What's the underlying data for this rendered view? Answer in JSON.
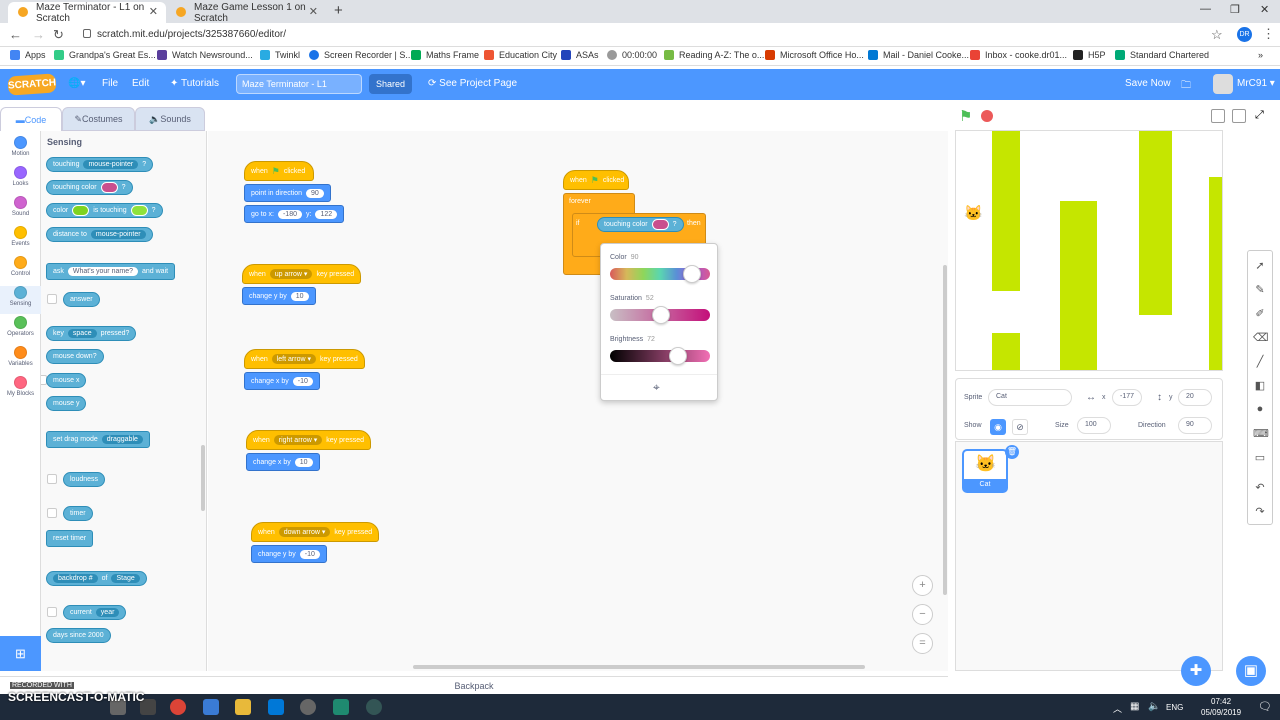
{
  "browser": {
    "tabs": [
      {
        "label": "Maze Terminator - L1 on Scratch"
      },
      {
        "label": "Maze Game Lesson 1 on Scratch"
      }
    ],
    "url": "scratch.mit.edu/projects/325387660/editor/",
    "profile": "DR",
    "bookmarks": [
      "Apps",
      "Grandpa's Great Es...",
      "Watch Newsround...",
      "Twinkl",
      "Screen Recorder | S...",
      "Maths Frame",
      "Education City",
      "ASAs",
      "00:00:00",
      "Reading A-Z: The o...",
      "Microsoft Office Ho...",
      "Mail - Daniel Cooke...",
      "Inbox - cooke.dr01...",
      "H5P",
      "Standard Chartered"
    ]
  },
  "menubar": {
    "logo": "SCRATCH",
    "file": "File",
    "edit": "Edit",
    "tutorials": "Tutorials",
    "project_title": "Maze Terminator - L1",
    "shared": "Shared",
    "see_project": "See Project Page",
    "save_now": "Save Now",
    "username": "MrC91"
  },
  "editor_tabs": {
    "code": "Code",
    "costumes": "Costumes",
    "sounds": "Sounds"
  },
  "categories": [
    {
      "label": "Motion",
      "color": "#4c97ff"
    },
    {
      "label": "Looks",
      "color": "#9966ff"
    },
    {
      "label": "Sound",
      "color": "#cf63cf"
    },
    {
      "label": "Events",
      "color": "#ffbf00"
    },
    {
      "label": "Control",
      "color": "#ffab19"
    },
    {
      "label": "Sensing",
      "color": "#5cb1d6"
    },
    {
      "label": "Operators",
      "color": "#59c059"
    },
    {
      "label": "Variables",
      "color": "#ff8c1a"
    },
    {
      "label": "My Blocks",
      "color": "#ff6680"
    }
  ],
  "palette": {
    "section": "Sensing",
    "touching": "touching",
    "mouse_pointer": "mouse-pointer",
    "q": "?",
    "touching_color": "touching color",
    "color": "color",
    "is_touching": "is touching",
    "distance_to": "distance to",
    "ask": "ask",
    "ask_default": "What's your name?",
    "and_wait": "and wait",
    "answer": "answer",
    "key": "key",
    "space": "space",
    "pressed": "pressed?",
    "mouse_down": "mouse down?",
    "mouse_x": "mouse x",
    "mouse_y": "mouse y",
    "set_drag": "set drag mode",
    "draggable": "draggable",
    "loudness": "loudness",
    "timer": "timer",
    "reset_timer": "reset timer",
    "backdrop": "backdrop #",
    "of": "of",
    "stage": "Stage",
    "current": "current",
    "year": "year",
    "days_since": "days since 2000"
  },
  "scripts": {
    "when": "when",
    "clicked": "clicked",
    "point_in_direction": "point in direction",
    "dir_val": "90",
    "go_to_x": "go to x:",
    "x_val": "-180",
    "y_label": "y:",
    "y_val": "122",
    "up_arrow": "up arrow",
    "key_pressed": "key pressed",
    "change_y_by": "change y by",
    "up_val": "10",
    "left_arrow": "left arrow",
    "change_x_by": "change x by",
    "left_val": "-10",
    "right_arrow": "right arrow",
    "right_val": "10",
    "down_arrow": "down arrow",
    "down_val": "-10",
    "forever": "forever",
    "if": "if",
    "touching_color": "touching color",
    "q": "?",
    "then": "then"
  },
  "color_picker": {
    "color_label": "Color",
    "color_value": "90",
    "saturation_label": "Saturation",
    "saturation_value": "52",
    "brightness_label": "Brightness",
    "brightness_value": "72"
  },
  "sprite_info": {
    "sprite_label": "Sprite",
    "sprite_name": "Cat",
    "x_label": "x",
    "x_value": "-177",
    "y_label": "y",
    "y_value": "20",
    "show_label": "Show",
    "size_label": "Size",
    "size_value": "100",
    "direction_label": "Direction",
    "direction_value": "90",
    "thumb_name": "Cat"
  },
  "backpack": "Backpack",
  "taskbar": {
    "lang": "ENG",
    "time": "07:42",
    "date": "05/09/2019"
  },
  "watermark": {
    "recorded": "RECORDED WITH",
    "brand": "SCREENCAST-O-MATIC"
  },
  "colors": {
    "accent": "#4c97ff",
    "maze_wall": "#c5e600",
    "touch_swatch": "#c94f8e",
    "green_swatch": "#7ed321"
  }
}
